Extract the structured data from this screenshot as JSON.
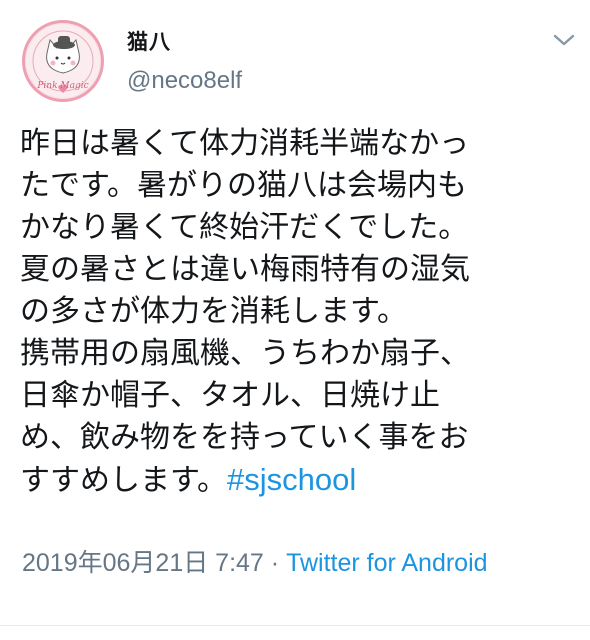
{
  "user": {
    "display_name": "猫八",
    "handle": "@neco8elf",
    "avatar_caption": "Pink Magic"
  },
  "icons": {
    "menu": "chevron-down-icon"
  },
  "tweet": {
    "lines": [
      "昨日は暑くて体力消耗半端なかっ",
      "たです。暑がりの猫八は会場内も",
      "かなり暑くて終始汗だくでした。",
      "夏の暑さとは違い梅雨特有の湿気",
      "の多さが体力を消耗します。",
      "携帯用の扇風機、うちわか扇子、",
      "日傘か帽子、タオル、日焼け止",
      "め、飲み物をを持っていく事をお"
    ],
    "last_line_text": "すすめします。",
    "hashtag": "#sjschool"
  },
  "meta": {
    "timestamp": "2019年06月21日 7:47 · ",
    "source": "Twitter for Android"
  },
  "colors": {
    "text": "#14171a",
    "secondary": "#657786",
    "link": "#1b95e0",
    "avatar_border": "#ee9fb1",
    "avatar_bg": "#f7dfe4"
  }
}
